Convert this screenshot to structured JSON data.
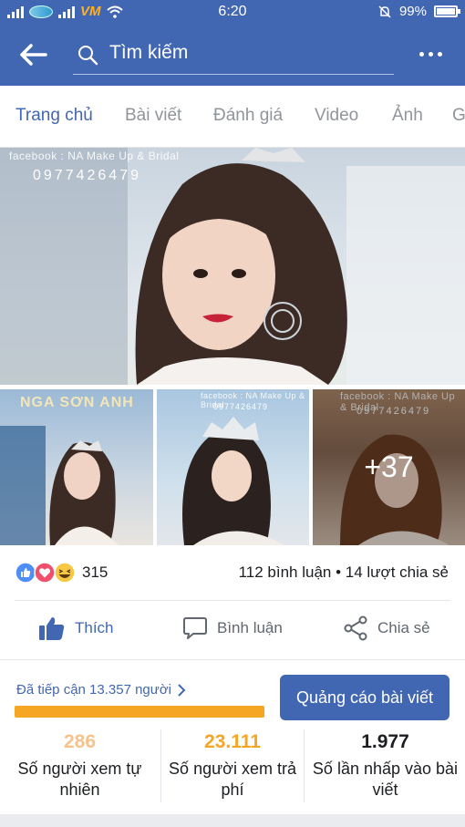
{
  "status_bar": {
    "time": "6:20",
    "battery": "99%"
  },
  "app_bar": {
    "search_placeholder": "Tìm kiếm"
  },
  "tabs": [
    {
      "label": "Trang chủ",
      "active": true
    },
    {
      "label": "Bài viết",
      "active": false
    },
    {
      "label": "Đánh giá",
      "active": false
    },
    {
      "label": "Video",
      "active": false
    },
    {
      "label": "Ảnh",
      "active": false
    },
    {
      "label": "G",
      "active": false
    }
  ],
  "photos": {
    "main_watermark": "facebook : NA Make Up & Bridal",
    "main_phone": "0977426479",
    "thumb1_salon": "NGA SƠN ANH",
    "thumb2_watermark": "facebook : NA Make Up & Bridal",
    "thumb2_phone": "0977426479",
    "thumb3_watermark": "facebook : NA Make Up & Bridal",
    "thumb3_phone": "0977426479",
    "more_count": "+37"
  },
  "reactions": {
    "icons": [
      "like-icon",
      "love-icon",
      "haha-icon"
    ],
    "count": "315",
    "engagement": "112 bình luận • 14 lượt chia sẻ"
  },
  "actions": {
    "like_label": "Thích",
    "comment_label": "Bình luận",
    "share_label": "Chia sẻ"
  },
  "insights": {
    "reach_text": "Đã tiếp cận 13.357 người",
    "boost_label": "Quảng cáo bài viết",
    "stats": [
      {
        "value": "286",
        "label": "Số người xem tự nhiên"
      },
      {
        "value": "23.111",
        "label": "Số người xem trả phí"
      },
      {
        "value": "1.977",
        "label": "Số lần nhấp vào bài viết"
      }
    ]
  },
  "colors": {
    "brand": "#4267b2",
    "accent_orange": "#f5a623",
    "light_orange": "#f7c38a"
  }
}
